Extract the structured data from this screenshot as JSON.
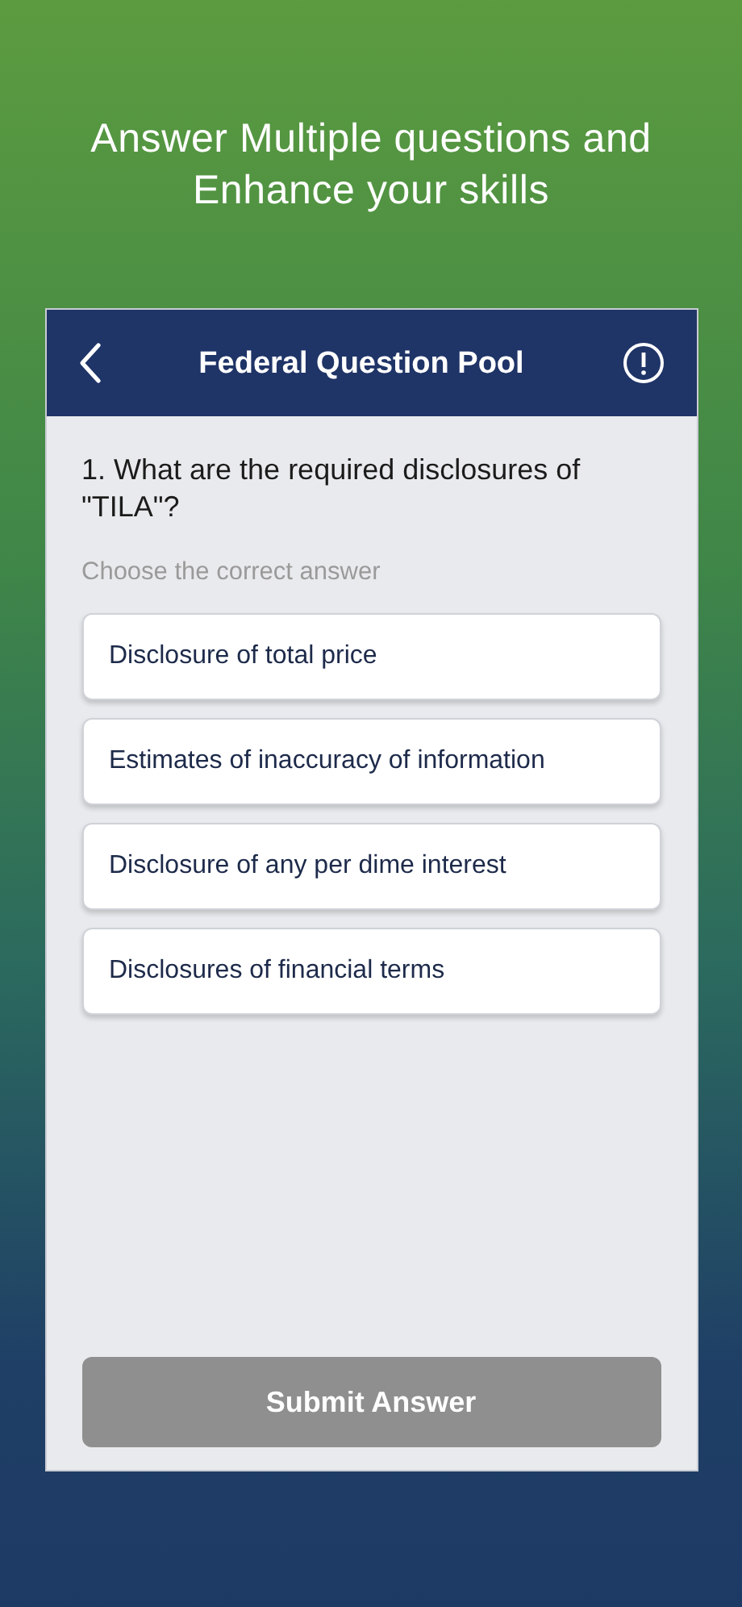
{
  "headline": "Answer Multiple questions and Enhance your skills",
  "header": {
    "title": "Federal Question Pool"
  },
  "question": "1. What are the required disclosures of \"TILA\"?",
  "instruction": "Choose the correct answer",
  "answers": [
    {
      "label": "Disclosure of total price",
      "selected": false
    },
    {
      "label": "Estimates of inaccuracy of information",
      "selected": false
    },
    {
      "label": "Disclosure of any per dime interest",
      "selected": false
    },
    {
      "label": "Disclosures of financial terms",
      "selected": false
    }
  ],
  "submit": {
    "label": "Submit Answer",
    "disabled": true
  }
}
